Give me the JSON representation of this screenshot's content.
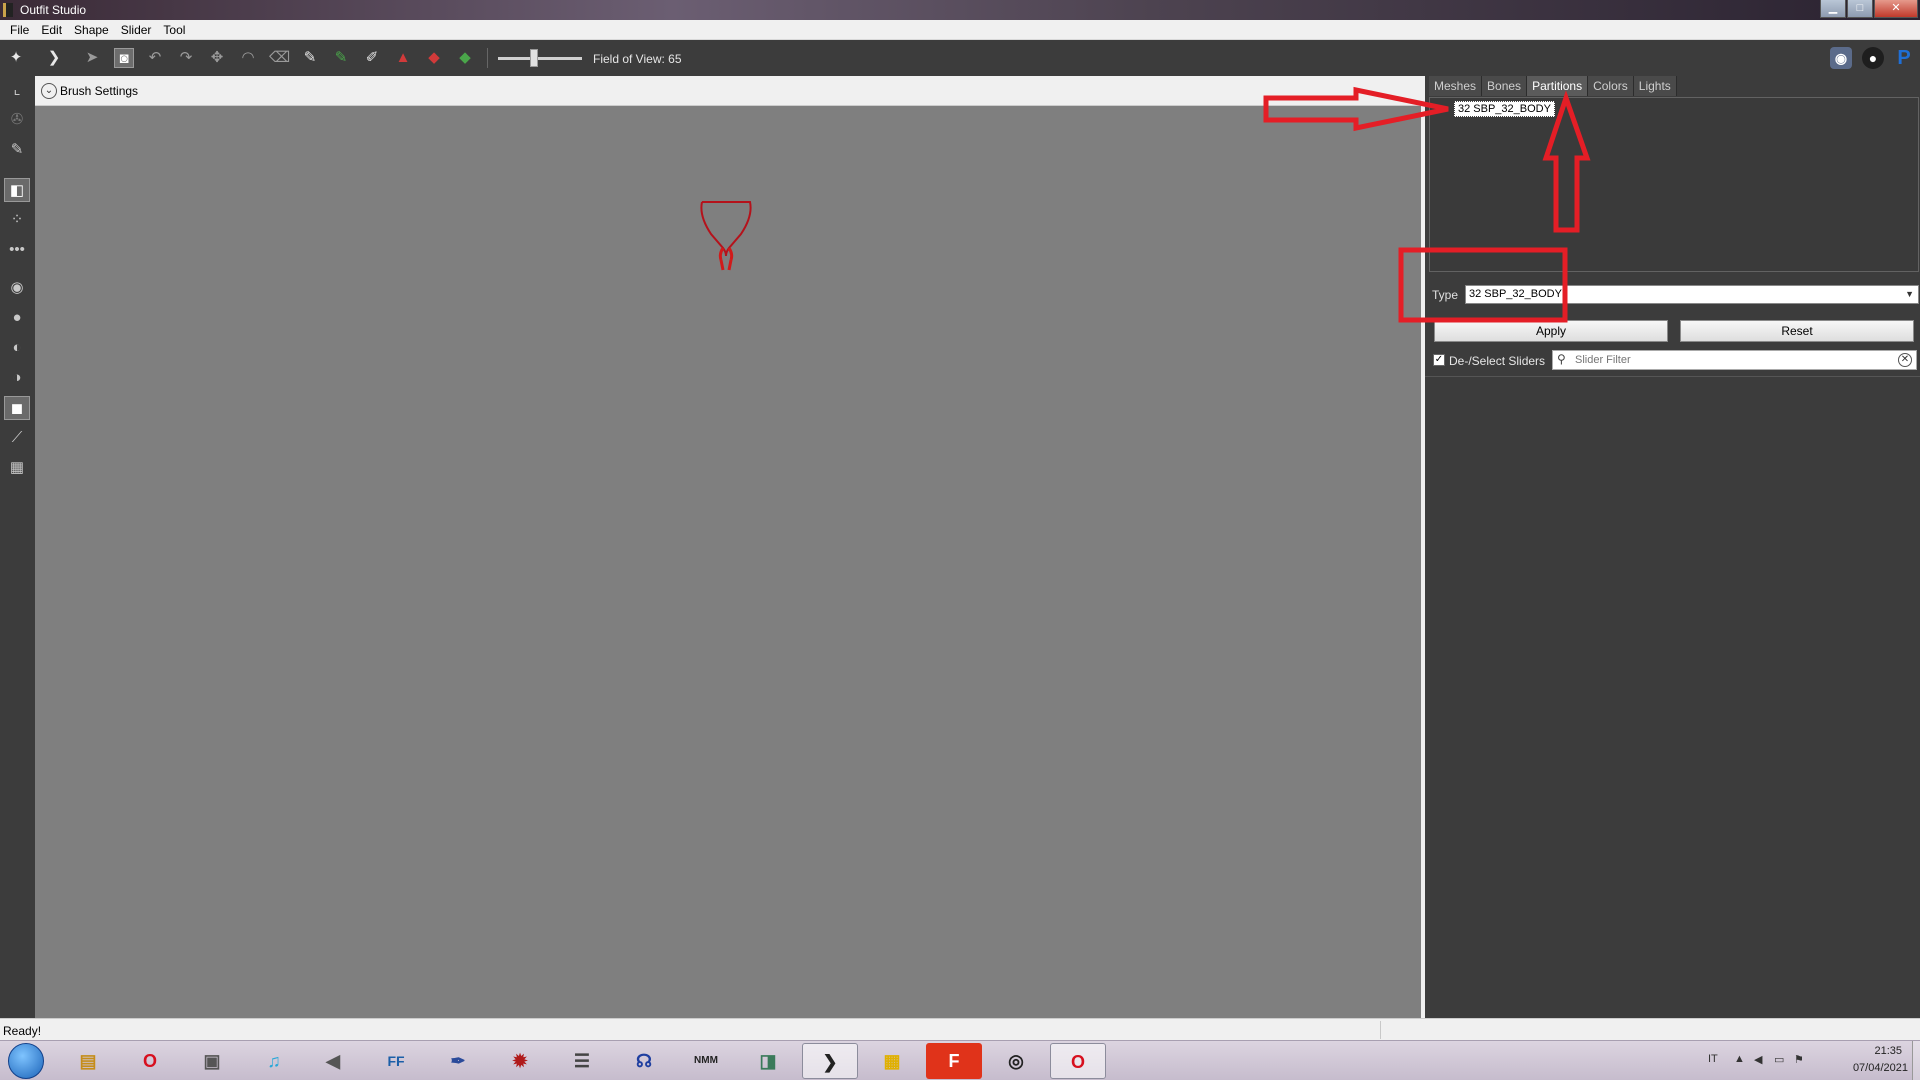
{
  "window": {
    "title": "Outfit Studio",
    "minimize": "▁",
    "maximize": "□",
    "close": "✕"
  },
  "menu": [
    "File",
    "Edit",
    "Shape",
    "Slider",
    "Tool"
  ],
  "toolbar": {
    "field_of_view_label": "Field of View: 65",
    "field_of_view_value": 65,
    "icons": [
      "select-icon",
      "transform-icon",
      "mask-brush-icon",
      "select-tool-icon",
      "undo-icon",
      "redo-icon",
      "move-icon",
      "smooth-icon",
      "erase-icon",
      "paint-icon",
      "weight-icon",
      "color-icon",
      "alpha-icon",
      "deflate-icon",
      "inflate-icon"
    ],
    "social": [
      "discord-icon",
      "github-icon",
      "paypal-icon"
    ]
  },
  "viewport": {
    "brush_settings_label": "Brush Settings"
  },
  "right_panel": {
    "tabs": [
      "Meshes",
      "Bones",
      "Partitions",
      "Colors",
      "Lights"
    ],
    "active_tab": "Partitions",
    "partitions": [
      "32 SBP_32_BODY"
    ],
    "type_label": "Type",
    "type_value": "32 SBP_32_BODY",
    "apply_label": "Apply",
    "reset_label": "Reset",
    "deselect_label": "De-/Select Sliders",
    "deselect_checked": true,
    "slider_filter_placeholder": "Slider Filter"
  },
  "status": {
    "text": "Ready!"
  },
  "taskbar": {
    "items": [
      "opera-icon",
      "file-explorer-icon",
      "media-player-icon",
      "music-icon",
      "volume-app-icon",
      "ffdec-icon",
      "quill-icon",
      "spider-app-icon",
      "mixer-icon",
      "headphones-icon",
      "nmm-icon",
      "viewer-icon",
      "outfit-studio-icon",
      "notes-icon",
      "f-app-icon",
      "creation-kit-icon",
      "opera-icon"
    ],
    "language": "IT",
    "time": "21:35",
    "date": "07/04/2021"
  },
  "colors": {
    "annotation": "#e41e26",
    "panel_bg": "#3c3c3c",
    "viewport_bg": "#7f7f7f"
  }
}
